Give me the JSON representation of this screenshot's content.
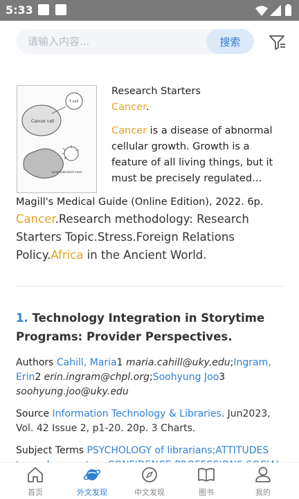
{
  "status_bar": {
    "time": "5:33"
  },
  "search": {
    "placeholder": "请输入内容...",
    "button_label": "搜索"
  },
  "featured": {
    "label": "Research Starters",
    "subject": "Cancer",
    "subject_suffix": ".",
    "abstract_term": "Cancer",
    "abstract_text": " is a disease of abnormal cellular growth. Growth is a feature of all living things, but it must be precisely regulated for…",
    "thumbnail_labels": {
      "cancer_cell": "Cancer cell",
      "t_cell": "T cell",
      "lymph": "Lymphoblastoid mass"
    },
    "source": "Magill's Medical Guide (Online Edition), 2022. 6p.",
    "subjects": [
      {
        "text": "Cancer",
        "highlight": true
      },
      {
        "text": ".Research methodology: Research Starters Topic.Stress.Foreign Relations Policy.",
        "highlight": false
      },
      {
        "text": "Africa",
        "highlight": true
      },
      {
        "text": " in the Ancient World.",
        "highlight": false
      }
    ]
  },
  "result": {
    "number": "1.",
    "title": "Technology Integration in Storytime Programs: Provider Perspectives.",
    "authors_label": "Authors",
    "author1_name": "Cahill, Maria",
    "author1_num": "1",
    "author1_email": "maria.cahill@uky.edu",
    "sep1": ";",
    "author2_name": "Ingram, Erin",
    "author2_num": "2",
    "author2_email": "erin.ingram@chpl.org",
    "sep2": ";",
    "author3_name": "Soohyung Joo",
    "author3_num": "3",
    "author3_email": "soohyung.joo@uky.edu",
    "source_label": "Source",
    "source_link": "Information Technology & Libraries",
    "source_rest": ". Jun2023, Vol. 42 Issue 2, p1-20. 20p. 3 Charts.",
    "terms_label": "Subject Terms",
    "terms_link": "PSYCHOLOGY of librarians;ATTITUDES toward computers;CONFIDENCE;PROFESSIONS;SOCIAL"
  },
  "tabs": [
    {
      "label": "首页",
      "icon": "home-icon",
      "active": false
    },
    {
      "label": "外文发现",
      "icon": "planet-icon",
      "active": true
    },
    {
      "label": "中文发现",
      "icon": "compass-icon",
      "active": false
    },
    {
      "label": "图书",
      "icon": "book-icon",
      "active": false
    },
    {
      "label": "我的",
      "icon": "user-icon",
      "active": false
    }
  ],
  "colors": {
    "accent": "#2f7fd6",
    "highlight": "#e6a01e",
    "statusbar": "#7a7a7a"
  }
}
